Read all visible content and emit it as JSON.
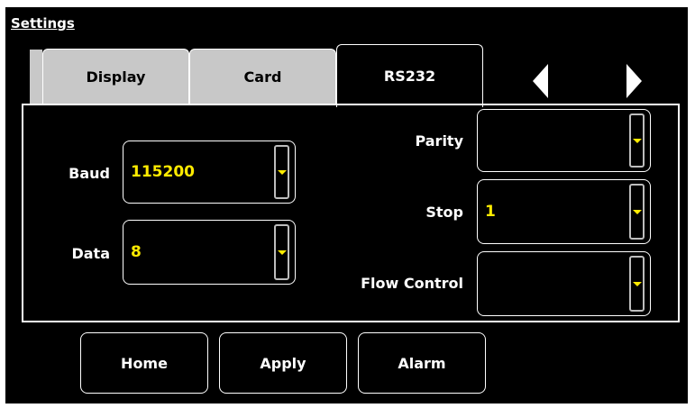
{
  "header": {
    "title": "Settings"
  },
  "tabs": [
    {
      "label": "Display",
      "active": false
    },
    {
      "label": "Card",
      "active": false
    },
    {
      "label": "RS232",
      "active": true
    }
  ],
  "fields": {
    "baud": {
      "label": "Baud",
      "value": "115200"
    },
    "data": {
      "label": "Data",
      "value": "8"
    },
    "parity": {
      "label": "Parity",
      "value": ""
    },
    "stop": {
      "label": "Stop",
      "value": "1"
    },
    "flow_control": {
      "label": "Flow Control",
      "value": ""
    }
  },
  "buttons": {
    "home": "Home",
    "apply": "Apply",
    "alarm": "Alarm"
  },
  "icons": {
    "prev": "triangle-left-icon",
    "next": "triangle-right-icon",
    "dropdown": "dropdown-arrow-icon"
  },
  "colors": {
    "background": "#000000",
    "value_text": "#ffeb00",
    "inactive_tab": "#c8c8c8",
    "foreground": "#ffffff"
  }
}
